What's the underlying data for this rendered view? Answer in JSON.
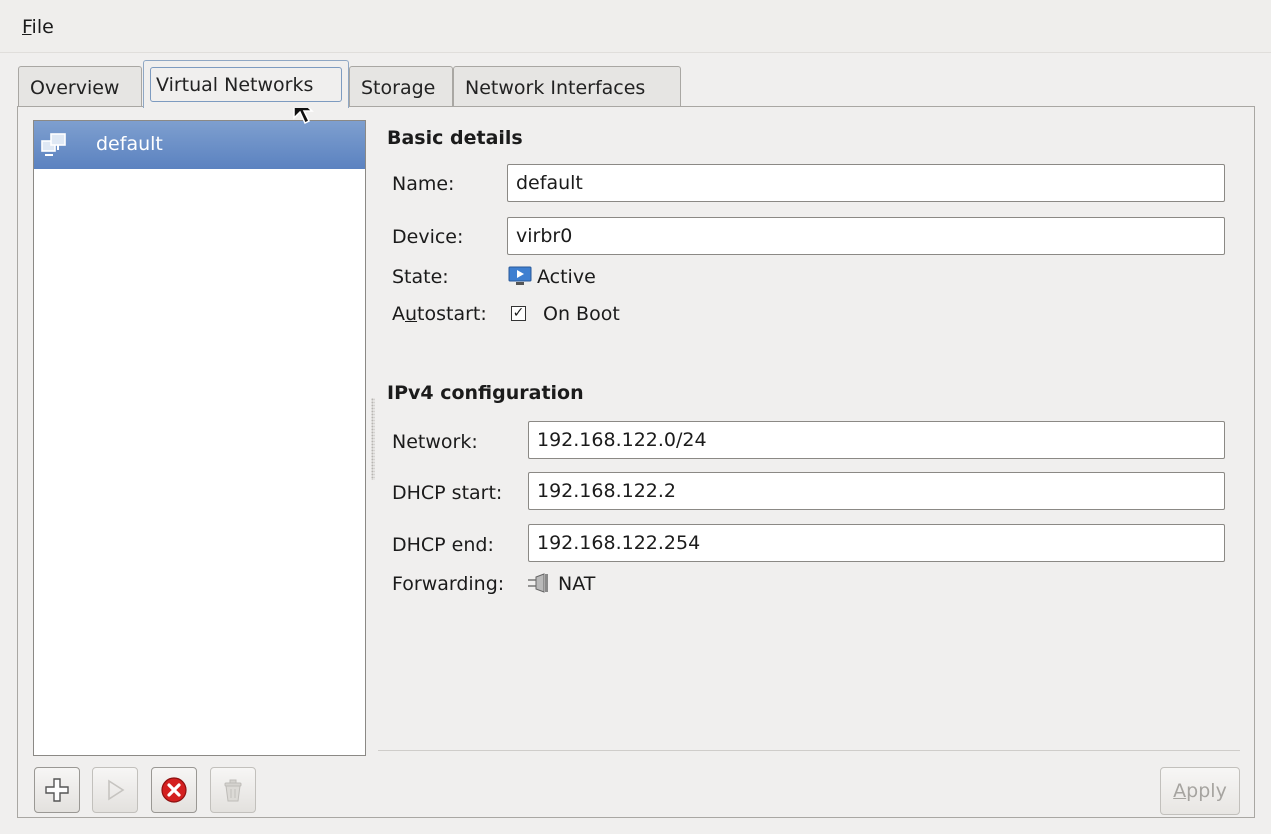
{
  "menubar": {
    "file_mnemonic": "F",
    "file_rest": "ile"
  },
  "tabs": [
    {
      "label": "Overview",
      "selected": false
    },
    {
      "label": "Virtual Networks",
      "selected": true
    },
    {
      "label": "Storage",
      "selected": false
    },
    {
      "label": "Network Interfaces",
      "selected": false
    }
  ],
  "network_list": [
    {
      "name": "default",
      "icon": "network-icon",
      "selected": true
    }
  ],
  "basic": {
    "heading": "Basic details",
    "name_label": "Name:",
    "name_value": "default",
    "device_label": "Device:",
    "device_value": "virbr0",
    "state_label": "State:",
    "state_value": "Active",
    "state_icon": "monitor-active-icon",
    "autostart_pre": "A",
    "autostart_mnemonic": "u",
    "autostart_post": "tostart:",
    "autostart_checked": true,
    "autostart_value": "On Boot"
  },
  "ipv4": {
    "heading": "IPv4 configuration",
    "network_label": "Network:",
    "network_value": "192.168.122.0/24",
    "dhcp_start_label": "DHCP start:",
    "dhcp_start_value": "192.168.122.2",
    "dhcp_end_label": "DHCP end:",
    "dhcp_end_value": "192.168.122.254",
    "forwarding_label": "Forwarding:",
    "forwarding_value": "NAT",
    "forwarding_icon": "nat-plug-icon"
  },
  "buttons": {
    "add_icon": "plus-icon",
    "start_icon": "play-icon",
    "stop_icon": "red-x-icon",
    "delete_icon": "trash-icon",
    "apply_mnemonic": "A",
    "apply_rest": "pply"
  },
  "colors": {
    "selection": "#5b82c0",
    "stop_red": "#d42020"
  }
}
